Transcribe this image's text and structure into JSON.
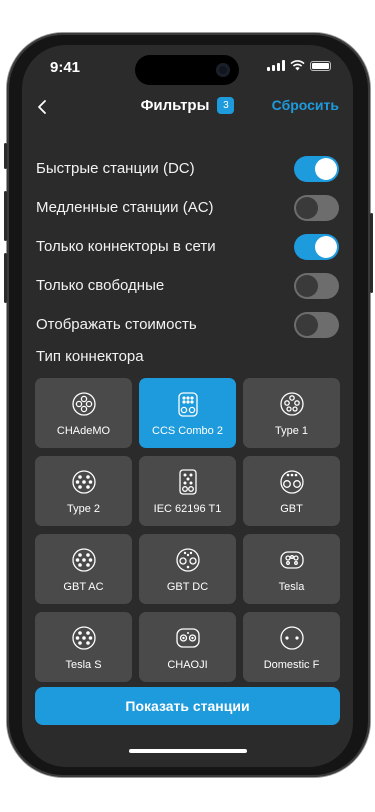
{
  "status_bar": {
    "time": "9:41"
  },
  "nav": {
    "title": "Фильтры",
    "badge": "3",
    "reset_label": "Сбросить"
  },
  "filters": [
    {
      "label": "Быстрые станции (DC)",
      "on": true
    },
    {
      "label": "Медленные станции (AC)",
      "on": false
    },
    {
      "label": "Только коннекторы в сети",
      "on": true
    },
    {
      "label": "Только свободные",
      "on": false
    },
    {
      "label": "Отображать стоимость",
      "on": false
    }
  ],
  "connector_section": {
    "title": "Тип коннектора"
  },
  "connectors": [
    {
      "label": "CHAdeMO",
      "icon": "chademo-icon",
      "selected": false
    },
    {
      "label": "CCS Combo 2",
      "icon": "ccs-combo-2-icon",
      "selected": true
    },
    {
      "label": "Type 1",
      "icon": "type-1-icon",
      "selected": false
    },
    {
      "label": "Type 2",
      "icon": "type-2-icon",
      "selected": false
    },
    {
      "label": "IEC 62196 T1",
      "icon": "iec-62196-t1-icon",
      "selected": false
    },
    {
      "label": "GBT",
      "icon": "gbt-icon",
      "selected": false
    },
    {
      "label": "GBT AC",
      "icon": "gbt-ac-icon",
      "selected": false
    },
    {
      "label": "GBT DC",
      "icon": "gbt-dc-icon",
      "selected": false
    },
    {
      "label": "Tesla",
      "icon": "tesla-icon",
      "selected": false
    },
    {
      "label": "Tesla S",
      "icon": "tesla-s-icon",
      "selected": false
    },
    {
      "label": "CHAOJI",
      "icon": "chaoji-icon",
      "selected": false
    },
    {
      "label": "Domestic F",
      "icon": "domestic-f-icon",
      "selected": false
    }
  ],
  "cta": {
    "label": "Показать станции"
  },
  "colors": {
    "accent": "#1e9bdc",
    "background": "#2b2b2b",
    "tile": "#4a4a4a",
    "switch_off": "#6d6d6d"
  }
}
